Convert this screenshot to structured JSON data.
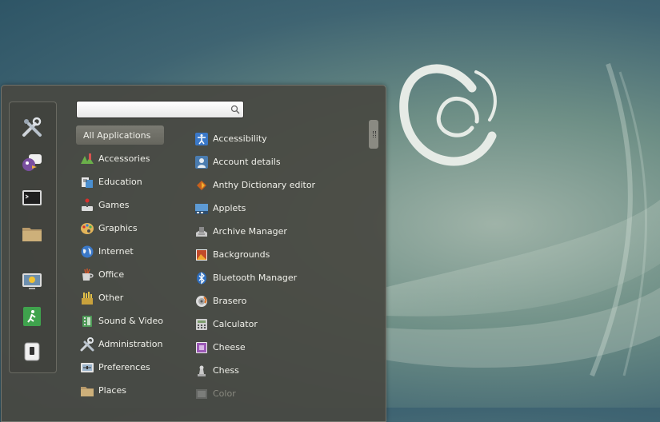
{
  "search": {
    "placeholder": "",
    "value": ""
  },
  "favorites": [
    {
      "icon": "settings-tools-icon"
    },
    {
      "icon": "pidgin-chat-icon"
    },
    {
      "icon": "terminal-icon"
    },
    {
      "icon": "folder-icon"
    },
    {
      "icon": "screensaver-lock-icon"
    },
    {
      "icon": "logout-exit-icon"
    },
    {
      "icon": "shutdown-icon"
    }
  ],
  "categories": [
    {
      "label": "All Applications",
      "icon": "",
      "selected": true
    },
    {
      "label": "Accessories",
      "icon": "accessories-icon"
    },
    {
      "label": "Education",
      "icon": "education-icon"
    },
    {
      "label": "Games",
      "icon": "games-icon"
    },
    {
      "label": "Graphics",
      "icon": "graphics-icon"
    },
    {
      "label": "Internet",
      "icon": "internet-icon"
    },
    {
      "label": "Office",
      "icon": "office-icon"
    },
    {
      "label": "Other",
      "icon": "other-icon"
    },
    {
      "label": "Sound & Video",
      "icon": "sound-video-icon"
    },
    {
      "label": "Administration",
      "icon": "administration-icon"
    },
    {
      "label": "Preferences",
      "icon": "preferences-icon"
    },
    {
      "label": "Places",
      "icon": "places-icon"
    }
  ],
  "apps": [
    {
      "label": "Accessibility",
      "icon": "accessibility-icon"
    },
    {
      "label": "Account details",
      "icon": "account-details-icon"
    },
    {
      "label": "Anthy Dictionary editor",
      "icon": "anthy-dictionary-icon"
    },
    {
      "label": "Applets",
      "icon": "applets-icon"
    },
    {
      "label": "Archive Manager",
      "icon": "archive-manager-icon"
    },
    {
      "label": "Backgrounds",
      "icon": "backgrounds-icon"
    },
    {
      "label": "Bluetooth Manager",
      "icon": "bluetooth-icon"
    },
    {
      "label": "Brasero",
      "icon": "brasero-icon"
    },
    {
      "label": "Calculator",
      "icon": "calculator-icon"
    },
    {
      "label": "Cheese",
      "icon": "cheese-icon"
    },
    {
      "label": "Chess",
      "icon": "chess-icon"
    },
    {
      "label": "Color",
      "icon": "color-icon",
      "dim": true
    }
  ]
}
